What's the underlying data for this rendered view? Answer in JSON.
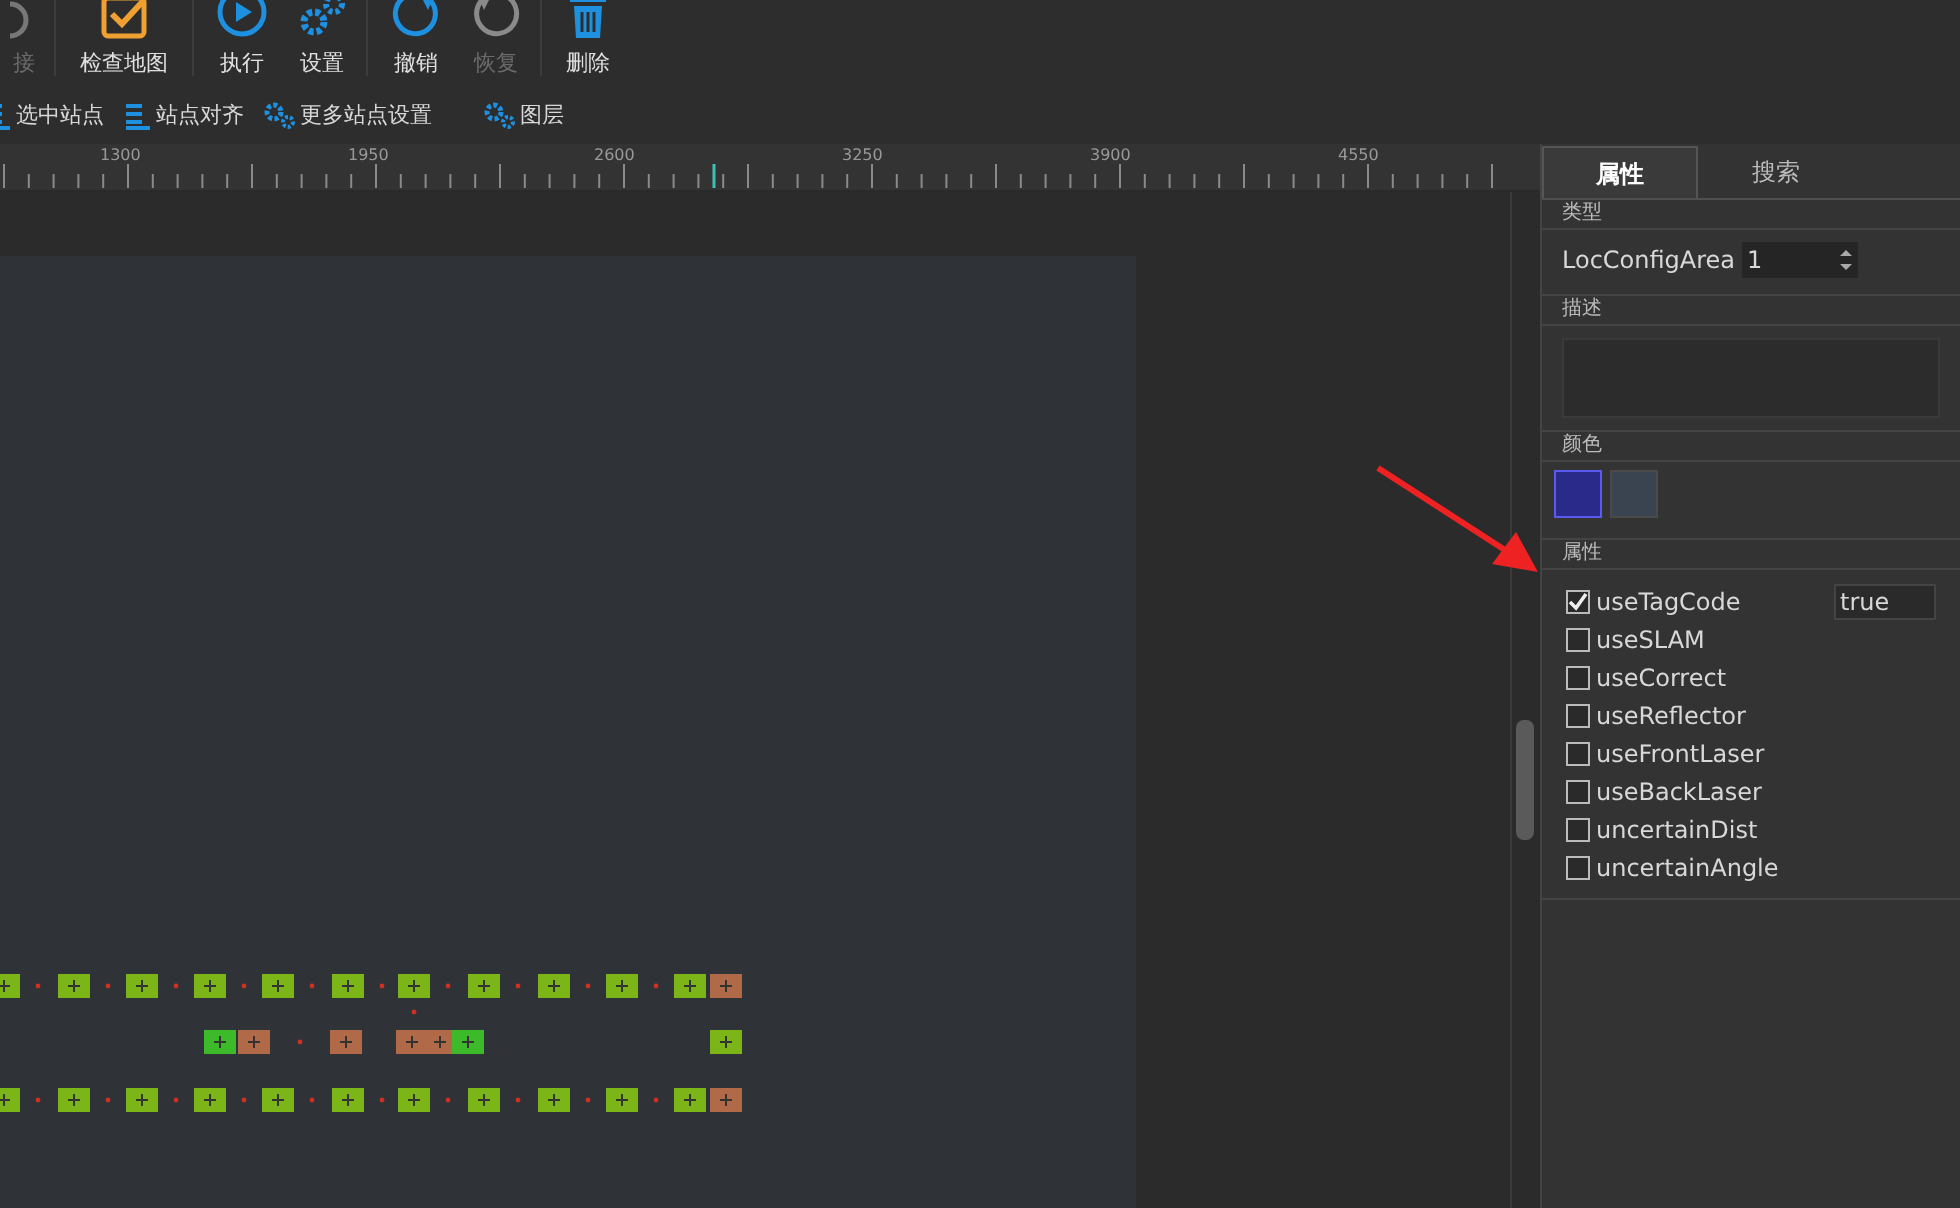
{
  "toolbar": [
    {
      "label": "接",
      "kind": "join",
      "disabled": true
    },
    {
      "label": "检查地图",
      "kind": "check",
      "disabled": false
    },
    {
      "label": "执行",
      "kind": "play",
      "disabled": false
    },
    {
      "label": "设置",
      "kind": "gears",
      "disabled": false
    },
    {
      "label": "撤销",
      "kind": "undo",
      "disabled": false
    },
    {
      "label": "恢复",
      "kind": "redo",
      "disabled": true
    },
    {
      "label": "删除",
      "kind": "trash",
      "disabled": false
    }
  ],
  "subtoolbar": [
    {
      "label": "选中站点",
      "kind": "list"
    },
    {
      "label": "站点对齐",
      "kind": "list"
    },
    {
      "label": "更多站点设置",
      "kind": "gears"
    },
    {
      "label": "图层",
      "kind": "gears"
    }
  ],
  "ruler": {
    "labels": [
      "1300",
      "1950",
      "2600",
      "3250",
      "3900",
      "4550"
    ]
  },
  "panel": {
    "tabs": [
      {
        "label": "属性",
        "selected": true
      },
      {
        "label": "搜索",
        "selected": false
      }
    ],
    "type_section": {
      "header": "类型",
      "label": "LocConfigArea",
      "value": "1"
    },
    "description": {
      "header": "描述"
    },
    "color": {
      "header": "颜色",
      "swatches": [
        {
          "color": "#2a2a8a",
          "selected": true
        },
        {
          "color": "#3a4450",
          "selected": false
        }
      ]
    },
    "properties": {
      "header": "属性",
      "items": [
        {
          "label": "useTagCode",
          "checked": true,
          "value": "true"
        },
        {
          "label": "useSLAM",
          "checked": false
        },
        {
          "label": "useCorrect",
          "checked": false
        },
        {
          "label": "useReflector",
          "checked": false
        },
        {
          "label": "useFrontLaser",
          "checked": false
        },
        {
          "label": "useBackLaser",
          "checked": false
        },
        {
          "label": "uncertainDist",
          "checked": false
        },
        {
          "label": "uncertainAngle",
          "checked": false
        }
      ]
    }
  }
}
